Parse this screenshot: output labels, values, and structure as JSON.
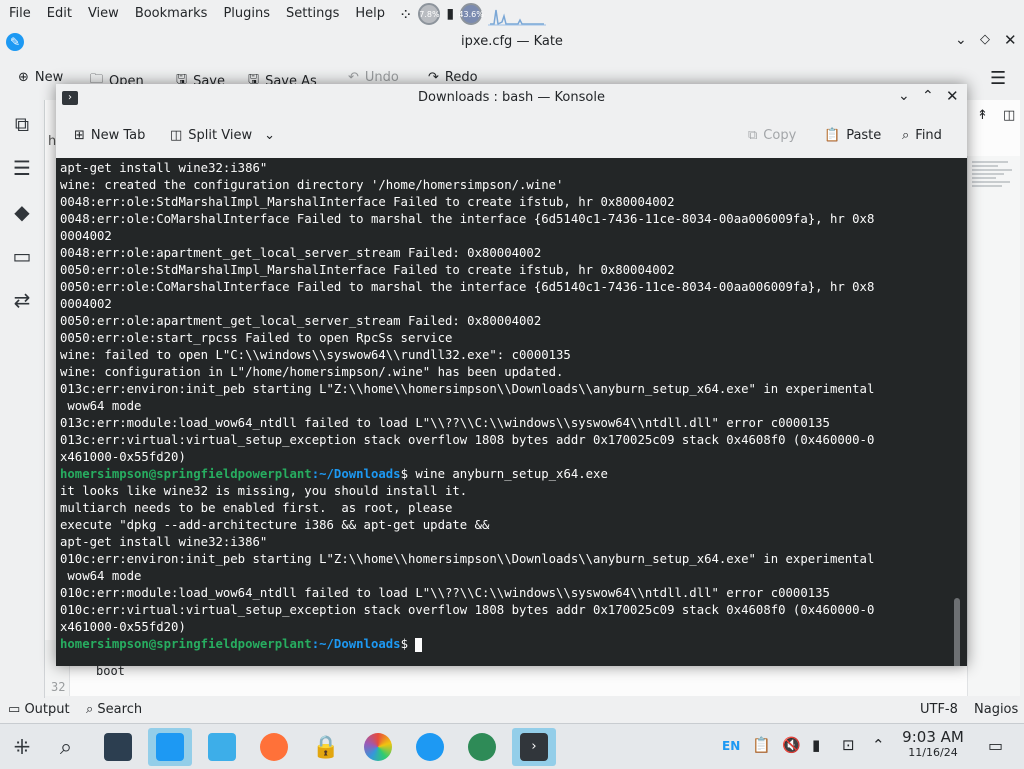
{
  "menubar": {
    "items": [
      "File",
      "Edit",
      "View",
      "Bookmarks",
      "Plugins",
      "Settings",
      "Help"
    ],
    "cpu_label": "7.8%",
    "mem_label": "43.6%"
  },
  "kate": {
    "title": "ipxe.cfg — Kate",
    "toolbar": {
      "new": "New",
      "open": "Open",
      "save": "Save",
      "save_as": "Save As",
      "undo": "Undo",
      "redo": "Redo"
    },
    "editor": {
      "line_numbers": [
        "32"
      ],
      "visible_text": "boot",
      "side_letter": "h"
    },
    "status": {
      "output": "Output",
      "search": "Search",
      "encoding": "UTF-8",
      "mode": "Nagios"
    }
  },
  "konsole": {
    "title": "Downloads : bash — Konsole",
    "toolbar": {
      "new_tab": "New Tab",
      "split_view": "Split View",
      "copy": "Copy",
      "paste": "Paste",
      "find": "Find"
    },
    "prompt_user": "homersimpson@springfieldpowerplant",
    "prompt_path": ":~/Downloads",
    "prompt_symbol": "$ ",
    "lines": [
      {
        "t": "apt-get install wine32:i386\""
      },
      {
        "t": "wine: created the configuration directory '/home/homersimpson/.wine'"
      },
      {
        "t": "0048:err:ole:StdMarshalImpl_MarshalInterface Failed to create ifstub, hr 0x80004002"
      },
      {
        "t": "0048:err:ole:CoMarshalInterface Failed to marshal the interface {6d5140c1-7436-11ce-8034-00aa006009fa}, hr 0x8"
      },
      {
        "t": "0004002"
      },
      {
        "t": "0048:err:ole:apartment_get_local_server_stream Failed: 0x80004002"
      },
      {
        "t": "0050:err:ole:StdMarshalImpl_MarshalInterface Failed to create ifstub, hr 0x80004002"
      },
      {
        "t": "0050:err:ole:CoMarshalInterface Failed to marshal the interface {6d5140c1-7436-11ce-8034-00aa006009fa}, hr 0x8"
      },
      {
        "t": "0004002"
      },
      {
        "t": "0050:err:ole:apartment_get_local_server_stream Failed: 0x80004002"
      },
      {
        "t": "0050:err:ole:start_rpcss Failed to open RpcSs service"
      },
      {
        "t": "wine: failed to open L\"C:\\\\windows\\\\syswow64\\\\rundll32.exe\": c0000135"
      },
      {
        "t": "wine: configuration in L\"/home/homersimpson/.wine\" has been updated."
      },
      {
        "t": "013c:err:environ:init_peb starting L\"Z:\\\\home\\\\homersimpson\\\\Downloads\\\\anyburn_setup_x64.exe\" in experimental"
      },
      {
        "t": " wow64 mode"
      },
      {
        "t": "013c:err:module:load_wow64_ntdll failed to load L\"\\\\??\\\\C:\\\\windows\\\\syswow64\\\\ntdll.dll\" error c0000135"
      },
      {
        "t": "013c:err:virtual:virtual_setup_exception stack overflow 1808 bytes addr 0x170025c09 stack 0x4608f0 (0x460000-0"
      },
      {
        "t": "x461000-0x55fd20)"
      },
      {
        "prompt": true,
        "cmd": "wine anyburn_setup_x64.exe"
      },
      {
        "t": "it looks like wine32 is missing, you should install it."
      },
      {
        "t": "multiarch needs to be enabled first.  as root, please"
      },
      {
        "t": "execute \"dpkg --add-architecture i386 && apt-get update &&"
      },
      {
        "t": "apt-get install wine32:i386\""
      },
      {
        "t": "010c:err:environ:init_peb starting L\"Z:\\\\home\\\\homersimpson\\\\Downloads\\\\anyburn_setup_x64.exe\" in experimental"
      },
      {
        "t": " wow64 mode"
      },
      {
        "t": "010c:err:module:load_wow64_ntdll failed to load L\"\\\\??\\\\C:\\\\windows\\\\syswow64\\\\ntdll.dll\" error c0000135"
      },
      {
        "t": "010c:err:virtual:virtual_setup_exception stack overflow 1808 bytes addr 0x170025c09 stack 0x4608f0 (0x460000-0"
      },
      {
        "t": "x461000-0x55fd20)"
      },
      {
        "prompt": true,
        "cmd": "",
        "cursor": true
      }
    ]
  },
  "taskbar": {
    "language": "EN",
    "time": "9:03 AM",
    "date": "11/16/24"
  },
  "colors": {
    "terminal_bg": "#232627",
    "prompt_user": "#27ad60",
    "prompt_path": "#1d99f3",
    "active_task": "#93cee9"
  }
}
